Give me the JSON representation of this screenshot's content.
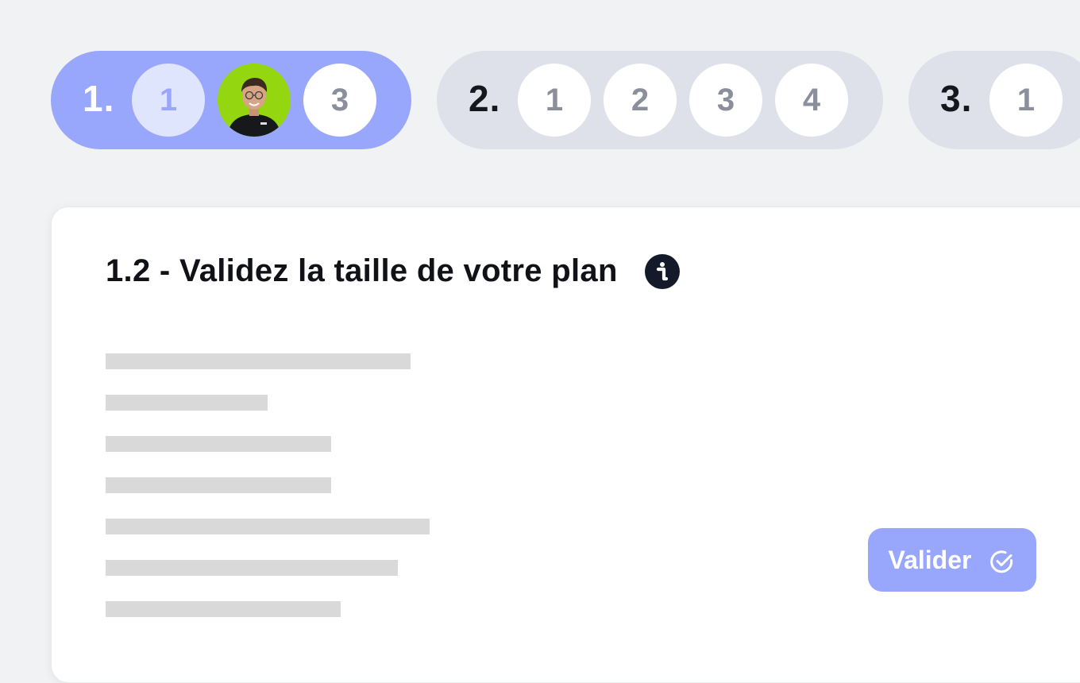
{
  "stepper": {
    "groups": [
      {
        "number": "1.",
        "state": "active",
        "substeps": [
          {
            "label": "1",
            "state": "done"
          },
          {
            "label": "",
            "state": "current",
            "icon": "user-avatar"
          },
          {
            "label": "3",
            "state": "todo"
          }
        ]
      },
      {
        "number": "2.",
        "state": "inactive",
        "substeps": [
          {
            "label": "1",
            "state": "todo"
          },
          {
            "label": "2",
            "state": "todo"
          },
          {
            "label": "3",
            "state": "todo"
          },
          {
            "label": "4",
            "state": "todo"
          }
        ]
      },
      {
        "number": "3.",
        "state": "inactive",
        "substeps": [
          {
            "label": "1",
            "state": "todo"
          }
        ]
      }
    ]
  },
  "card": {
    "title": "1.2 - Validez la taille de votre plan",
    "info_icon": "info-icon",
    "placeholder_line_count": 7,
    "validate_label": "Valider",
    "validate_icon": "check-circle-icon"
  },
  "colors": {
    "accent": "#98a7fb",
    "accent_light": "#dfe5fd",
    "inactive_group": "#dfe1ea",
    "avatar_bg": "#94d60f",
    "placeholder": "#d9d9d9",
    "info_bg": "#141a2a"
  }
}
